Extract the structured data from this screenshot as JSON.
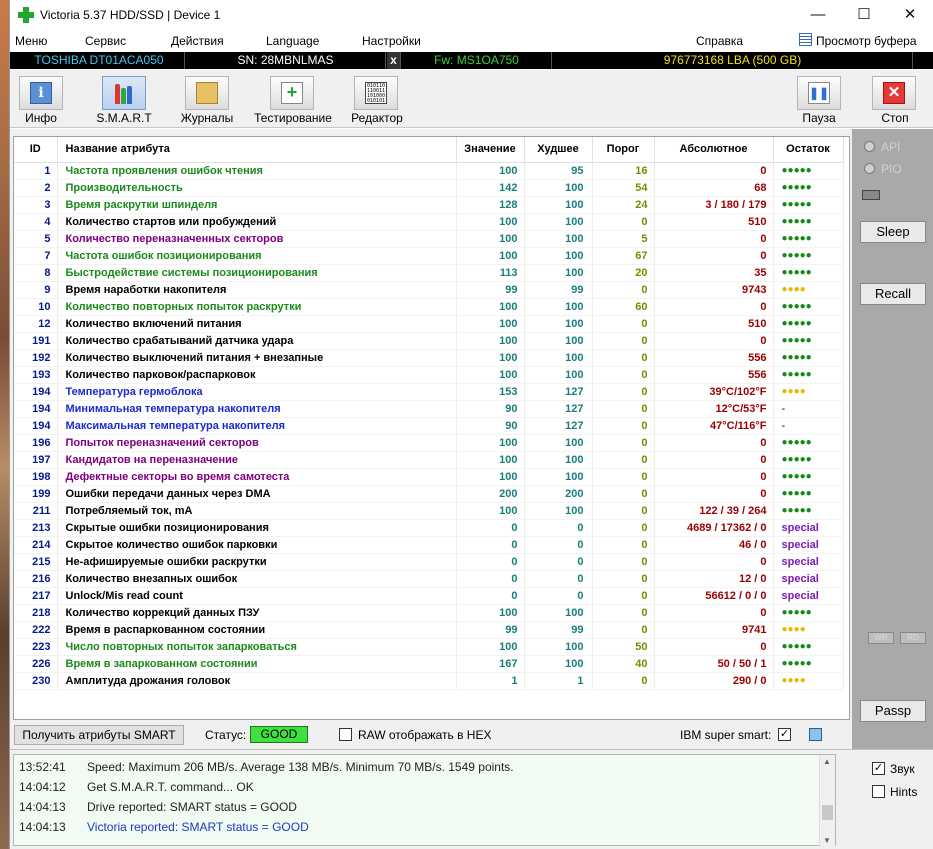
{
  "window": {
    "title": "Victoria 5.37 HDD/SSD | Device 1"
  },
  "menu": {
    "items": [
      "Меню",
      "Сервис",
      "Действия",
      "Language",
      "Настройки",
      "Справка"
    ],
    "buffer_view": "Просмотр буфера"
  },
  "device": {
    "model": "TOSHIBA DT01ACA050",
    "serial": "SN: 28MBNLMAS",
    "x": "x",
    "firmware": "Fw: MS1OA750",
    "lba": "976773168 LBA (500 GB)"
  },
  "toolbar": {
    "info": "Инфо",
    "smart": "S.M.A.R.T",
    "journals": "Журналы",
    "testing": "Тестирование",
    "editor": "Редактор",
    "pause": "Пауза",
    "stop": "Стоп",
    "editor_icon_text": "010110 110011 101000 010101"
  },
  "smart_table": {
    "headers": {
      "id": "ID",
      "name": "Название атрибута",
      "value": "Значение",
      "worst": "Худшее",
      "threshold": "Порог",
      "raw": "Абсолютное",
      "health": "Остаток"
    },
    "rows": [
      {
        "id": "1",
        "name": "Частота проявления ошибок чтения",
        "value": "100",
        "worst": "95",
        "threshold": "16",
        "raw": "0",
        "health": "●●●●●",
        "name_color": "green",
        "health_type": "green"
      },
      {
        "id": "2",
        "name": "Производительность",
        "value": "142",
        "worst": "100",
        "threshold": "54",
        "raw": "68",
        "health": "●●●●●",
        "name_color": "green",
        "health_type": "green"
      },
      {
        "id": "3",
        "name": "Время раскрутки шпинделя",
        "value": "128",
        "worst": "100",
        "threshold": "24",
        "raw": "3 / 180 / 179",
        "health": "●●●●●",
        "name_color": "green",
        "health_type": "green"
      },
      {
        "id": "4",
        "name": "Количество стартов или пробуждений",
        "value": "100",
        "worst": "100",
        "threshold": "0",
        "raw": "510",
        "health": "●●●●●",
        "name_color": "black",
        "health_type": "green"
      },
      {
        "id": "5",
        "name": "Количество переназначенных секторов",
        "value": "100",
        "worst": "100",
        "threshold": "5",
        "raw": "0",
        "health": "●●●●●",
        "name_color": "purple",
        "health_type": "green"
      },
      {
        "id": "7",
        "name": "Частота ошибок позиционирования",
        "value": "100",
        "worst": "100",
        "threshold": "67",
        "raw": "0",
        "health": "●●●●●",
        "name_color": "green",
        "health_type": "green"
      },
      {
        "id": "8",
        "name": "Быстродействие системы позиционирования",
        "value": "113",
        "worst": "100",
        "threshold": "20",
        "raw": "35",
        "health": "●●●●●",
        "name_color": "green",
        "health_type": "green"
      },
      {
        "id": "9",
        "name": "Время наработки накопителя",
        "value": "99",
        "worst": "99",
        "threshold": "0",
        "raw": "9743",
        "health": "●●●●",
        "name_color": "black",
        "health_type": "yellow"
      },
      {
        "id": "10",
        "name": "Количество повторных попыток раскрутки",
        "value": "100",
        "worst": "100",
        "threshold": "60",
        "raw": "0",
        "health": "●●●●●",
        "name_color": "green",
        "health_type": "green"
      },
      {
        "id": "12",
        "name": "Количество включений питания",
        "value": "100",
        "worst": "100",
        "threshold": "0",
        "raw": "510",
        "health": "●●●●●",
        "name_color": "black",
        "health_type": "green"
      },
      {
        "id": "191",
        "name": "Количество срабатываний датчика удара",
        "value": "100",
        "worst": "100",
        "threshold": "0",
        "raw": "0",
        "health": "●●●●●",
        "name_color": "black",
        "health_type": "green"
      },
      {
        "id": "192",
        "name": "Количество выключений питания + внезапные",
        "value": "100",
        "worst": "100",
        "threshold": "0",
        "raw": "556",
        "health": "●●●●●",
        "name_color": "black",
        "health_type": "green"
      },
      {
        "id": "193",
        "name": "Количество парковок/распарковок",
        "value": "100",
        "worst": "100",
        "threshold": "0",
        "raw": "556",
        "health": "●●●●●",
        "name_color": "black",
        "health_type": "green"
      },
      {
        "id": "194",
        "name": "Температура гермоблока",
        "value": "153",
        "worst": "127",
        "threshold": "0",
        "raw": "39°C/102°F",
        "health": "●●●●",
        "name_color": "blue",
        "health_type": "yellow"
      },
      {
        "id": "194",
        "name": "Минимальная температура накопителя",
        "value": "90",
        "worst": "127",
        "threshold": "0",
        "raw": "12°C/53°F",
        "health": "-",
        "name_color": "blue",
        "health_type": "dash"
      },
      {
        "id": "194",
        "name": "Максимальная температура накопителя",
        "value": "90",
        "worst": "127",
        "threshold": "0",
        "raw": "47°C/116°F",
        "health": "-",
        "name_color": "blue",
        "health_type": "dash"
      },
      {
        "id": "196",
        "name": "Попыток переназначений секторов",
        "value": "100",
        "worst": "100",
        "threshold": "0",
        "raw": "0",
        "health": "●●●●●",
        "name_color": "purple",
        "health_type": "green"
      },
      {
        "id": "197",
        "name": "Кандидатов на переназначение",
        "value": "100",
        "worst": "100",
        "threshold": "0",
        "raw": "0",
        "health": "●●●●●",
        "name_color": "purple",
        "health_type": "green"
      },
      {
        "id": "198",
        "name": "Дефектные секторы во время самотеста",
        "value": "100",
        "worst": "100",
        "threshold": "0",
        "raw": "0",
        "health": "●●●●●",
        "name_color": "purple",
        "health_type": "green"
      },
      {
        "id": "199",
        "name": "Ошибки передачи данных через DMA",
        "value": "200",
        "worst": "200",
        "threshold": "0",
        "raw": "0",
        "health": "●●●●●",
        "name_color": "black",
        "health_type": "green"
      },
      {
        "id": "211",
        "name": "Потребляемый ток, mA",
        "value": "100",
        "worst": "100",
        "threshold": "0",
        "raw": "122 / 39 / 264",
        "health": "●●●●●",
        "name_color": "black",
        "health_type": "green"
      },
      {
        "id": "213",
        "name": "Скрытые ошибки позиционирования",
        "value": "0",
        "worst": "0",
        "threshold": "0",
        "raw": "4689 / 17362 / 0",
        "health": "special",
        "name_color": "black",
        "health_type": "special"
      },
      {
        "id": "214",
        "name": "Скрытое количество ошибок парковки",
        "value": "0",
        "worst": "0",
        "threshold": "0",
        "raw": "46 / 0",
        "health": "special",
        "name_color": "black",
        "health_type": "special"
      },
      {
        "id": "215",
        "name": "Не-афишируемые ошибки раскрутки",
        "value": "0",
        "worst": "0",
        "threshold": "0",
        "raw": "0",
        "health": "special",
        "name_color": "black",
        "health_type": "special"
      },
      {
        "id": "216",
        "name": "Количество внезапных ошибок",
        "value": "0",
        "worst": "0",
        "threshold": "0",
        "raw": "12 / 0",
        "health": "special",
        "name_color": "black",
        "health_type": "special"
      },
      {
        "id": "217",
        "name": "Unlock/Mis read count",
        "value": "0",
        "worst": "0",
        "threshold": "0",
        "raw": "56612 / 0 / 0",
        "health": "special",
        "name_color": "black",
        "health_type": "special"
      },
      {
        "id": "218",
        "name": "Количество коррекций данных ПЗУ",
        "value": "100",
        "worst": "100",
        "threshold": "0",
        "raw": "0",
        "health": "●●●●●",
        "name_color": "black",
        "health_type": "green"
      },
      {
        "id": "222",
        "name": "Время в распаркованном состоянии",
        "value": "99",
        "worst": "99",
        "threshold": "0",
        "raw": "9741",
        "health": "●●●●",
        "name_color": "black",
        "health_type": "yellow"
      },
      {
        "id": "223",
        "name": "Число повторных попыток запарковаться",
        "value": "100",
        "worst": "100",
        "threshold": "50",
        "raw": "0",
        "health": "●●●●●",
        "name_color": "green",
        "health_type": "green"
      },
      {
        "id": "226",
        "name": "Время в запаркованном состоянии",
        "value": "167",
        "worst": "100",
        "threshold": "40",
        "raw": "50 / 50 / 1",
        "health": "●●●●●",
        "name_color": "green",
        "health_type": "green"
      },
      {
        "id": "230",
        "name": "Амплитуда дрожания головок",
        "value": "1",
        "worst": "1",
        "threshold": "0",
        "raw": "290 / 0",
        "health": "●●●●",
        "name_color": "black",
        "health_type": "yellow"
      }
    ]
  },
  "status_bar": {
    "get_smart_button": "Получить атрибуты SMART",
    "status_label": "Статус:",
    "status_value": "GOOD",
    "raw_hex_label": "RAW отображать в HEX",
    "raw_hex_checked": false,
    "ibm_label": "IBM super smart:",
    "ibm_checked": true,
    "check_mark": "✓"
  },
  "right_panel": {
    "api_label": "API",
    "pio_label": "PIO",
    "sleep_button": "Sleep",
    "recall_button": "Recall",
    "wr_label": "WR",
    "rd_label": "RD",
    "passp_button": "Passp"
  },
  "log": [
    {
      "time": "13:52:41",
      "message": "Speed: Maximum 206 MB/s. Average 138 MB/s. Minimum 70 MB/s. 1549 points.",
      "color": "normal"
    },
    {
      "time": "14:04:12",
      "message": "Get S.M.A.R.T. command... OK",
      "color": "normal"
    },
    {
      "time": "14:04:13",
      "message": "Drive reported: SMART status = GOOD",
      "color": "normal"
    },
    {
      "time": "14:04:13",
      "message": "Victoria reported: SMART status = GOOD",
      "color": "blue"
    }
  ],
  "options": {
    "sound_label": "Звук",
    "sound_checked": true,
    "hints_label": "Hints",
    "hints_checked": false
  },
  "colors": {
    "status_good": "#3fe03f",
    "health_green": "#138a13",
    "health_yellow": "#e6b800",
    "special": "#7a1bb8",
    "raw_value": "#9a0000",
    "value_teal": "#18807a"
  }
}
